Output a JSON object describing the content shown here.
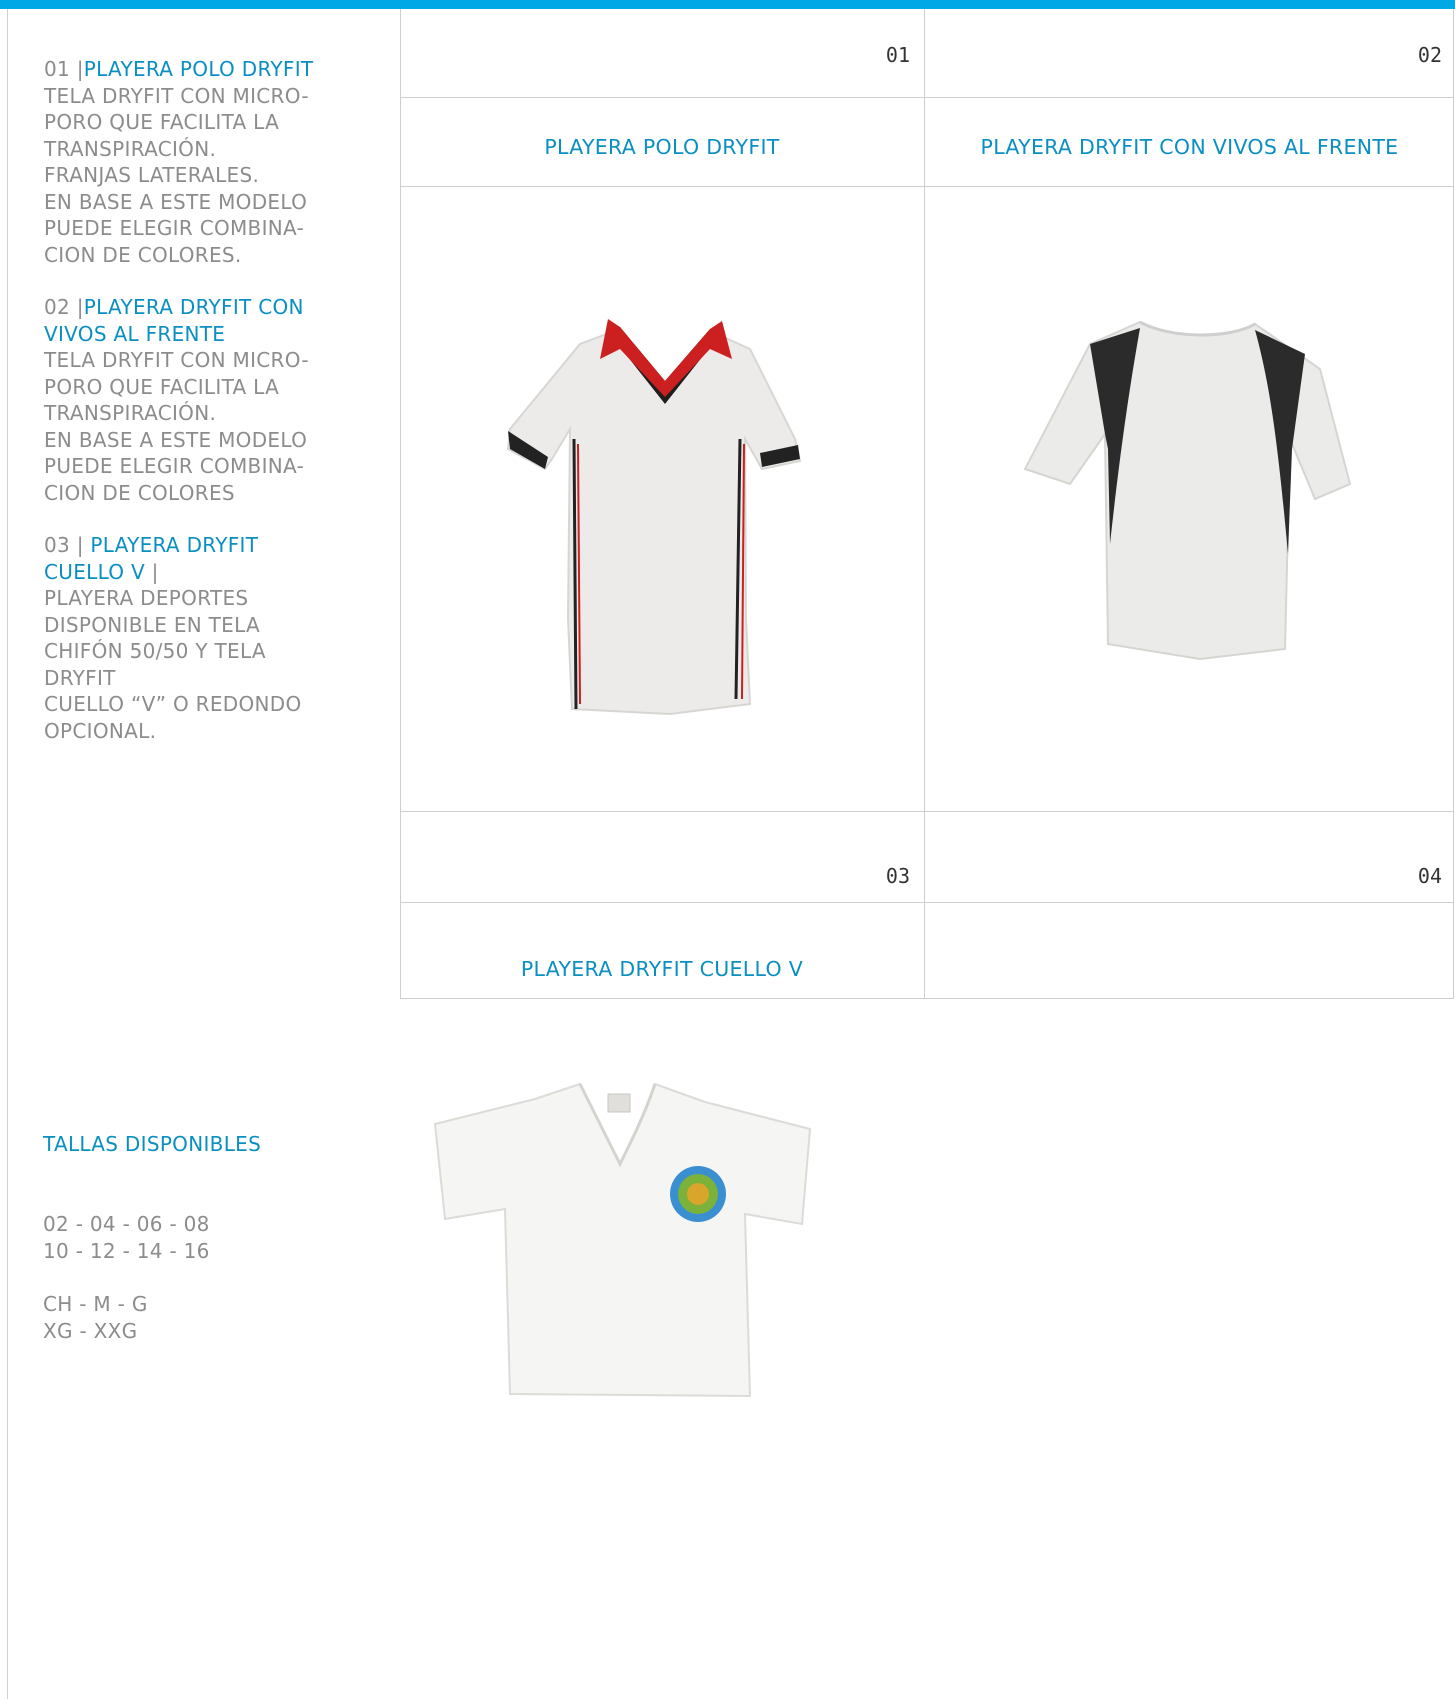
{
  "sidebar": {
    "item1": {
      "prefix": "01 |",
      "name": "PLAYERA POLO DRYFIT",
      "lines": [
        "TELA DRYFIT CON MICRO-",
        "PORO QUE FACILITA LA",
        "TRANSPIRACIÓN.",
        "FRANJAS LATERALES.",
        "EN BASE A ESTE MODELO",
        "PUEDE ELEGIR COMBINA-",
        "CION DE COLORES."
      ]
    },
    "item2": {
      "prefix": "02 |",
      "name_line1": "PLAYERA DRYFIT CON",
      "name_line2": "VIVOS AL FRENTE",
      "lines": [
        "TELA DRYFIT CON MICRO-",
        "PORO QUE FACILITA LA",
        "TRANSPIRACIÓN.",
        "EN BASE A ESTE MODELO",
        "PUEDE ELEGIR COMBINA-",
        "CION DE COLORES"
      ]
    },
    "item3": {
      "prefix": "03 | ",
      "name_line1": "PLAYERA DRYFIT",
      "name_line2": "CUELLO V",
      "suffix": " |",
      "lines": [
        "PLAYERA DEPORTES",
        "DISPONIBLE EN TELA",
        "CHIFÓN 50/50 Y TELA",
        "DRYFIT",
        "CUELLO “V” O REDONDO",
        "OPCIONAL."
      ]
    }
  },
  "grid": {
    "cells": [
      {
        "number": "01",
        "title": "PLAYERA POLO DRYFIT"
      },
      {
        "number": "02",
        "title": "PLAYERA DRYFIT CON VIVOS AL FRENTE"
      },
      {
        "number": "03",
        "title": "PLAYERA DRYFIT CUELLO V"
      },
      {
        "number": "04",
        "title": ""
      }
    ]
  },
  "sizes": {
    "heading": "TALLAS DISPONIBLES",
    "numeric": [
      "02 - 04 - 06 - 08",
      "10 - 12 - 14 - 16"
    ],
    "letters": [
      "CH - M - G",
      "XG - XXG"
    ]
  },
  "colors": {
    "accent_bar": "#00a8e6",
    "accent_text": "#0a8fc2",
    "body_text": "#8c8c8c",
    "grid_line": "#cfcfcf"
  }
}
